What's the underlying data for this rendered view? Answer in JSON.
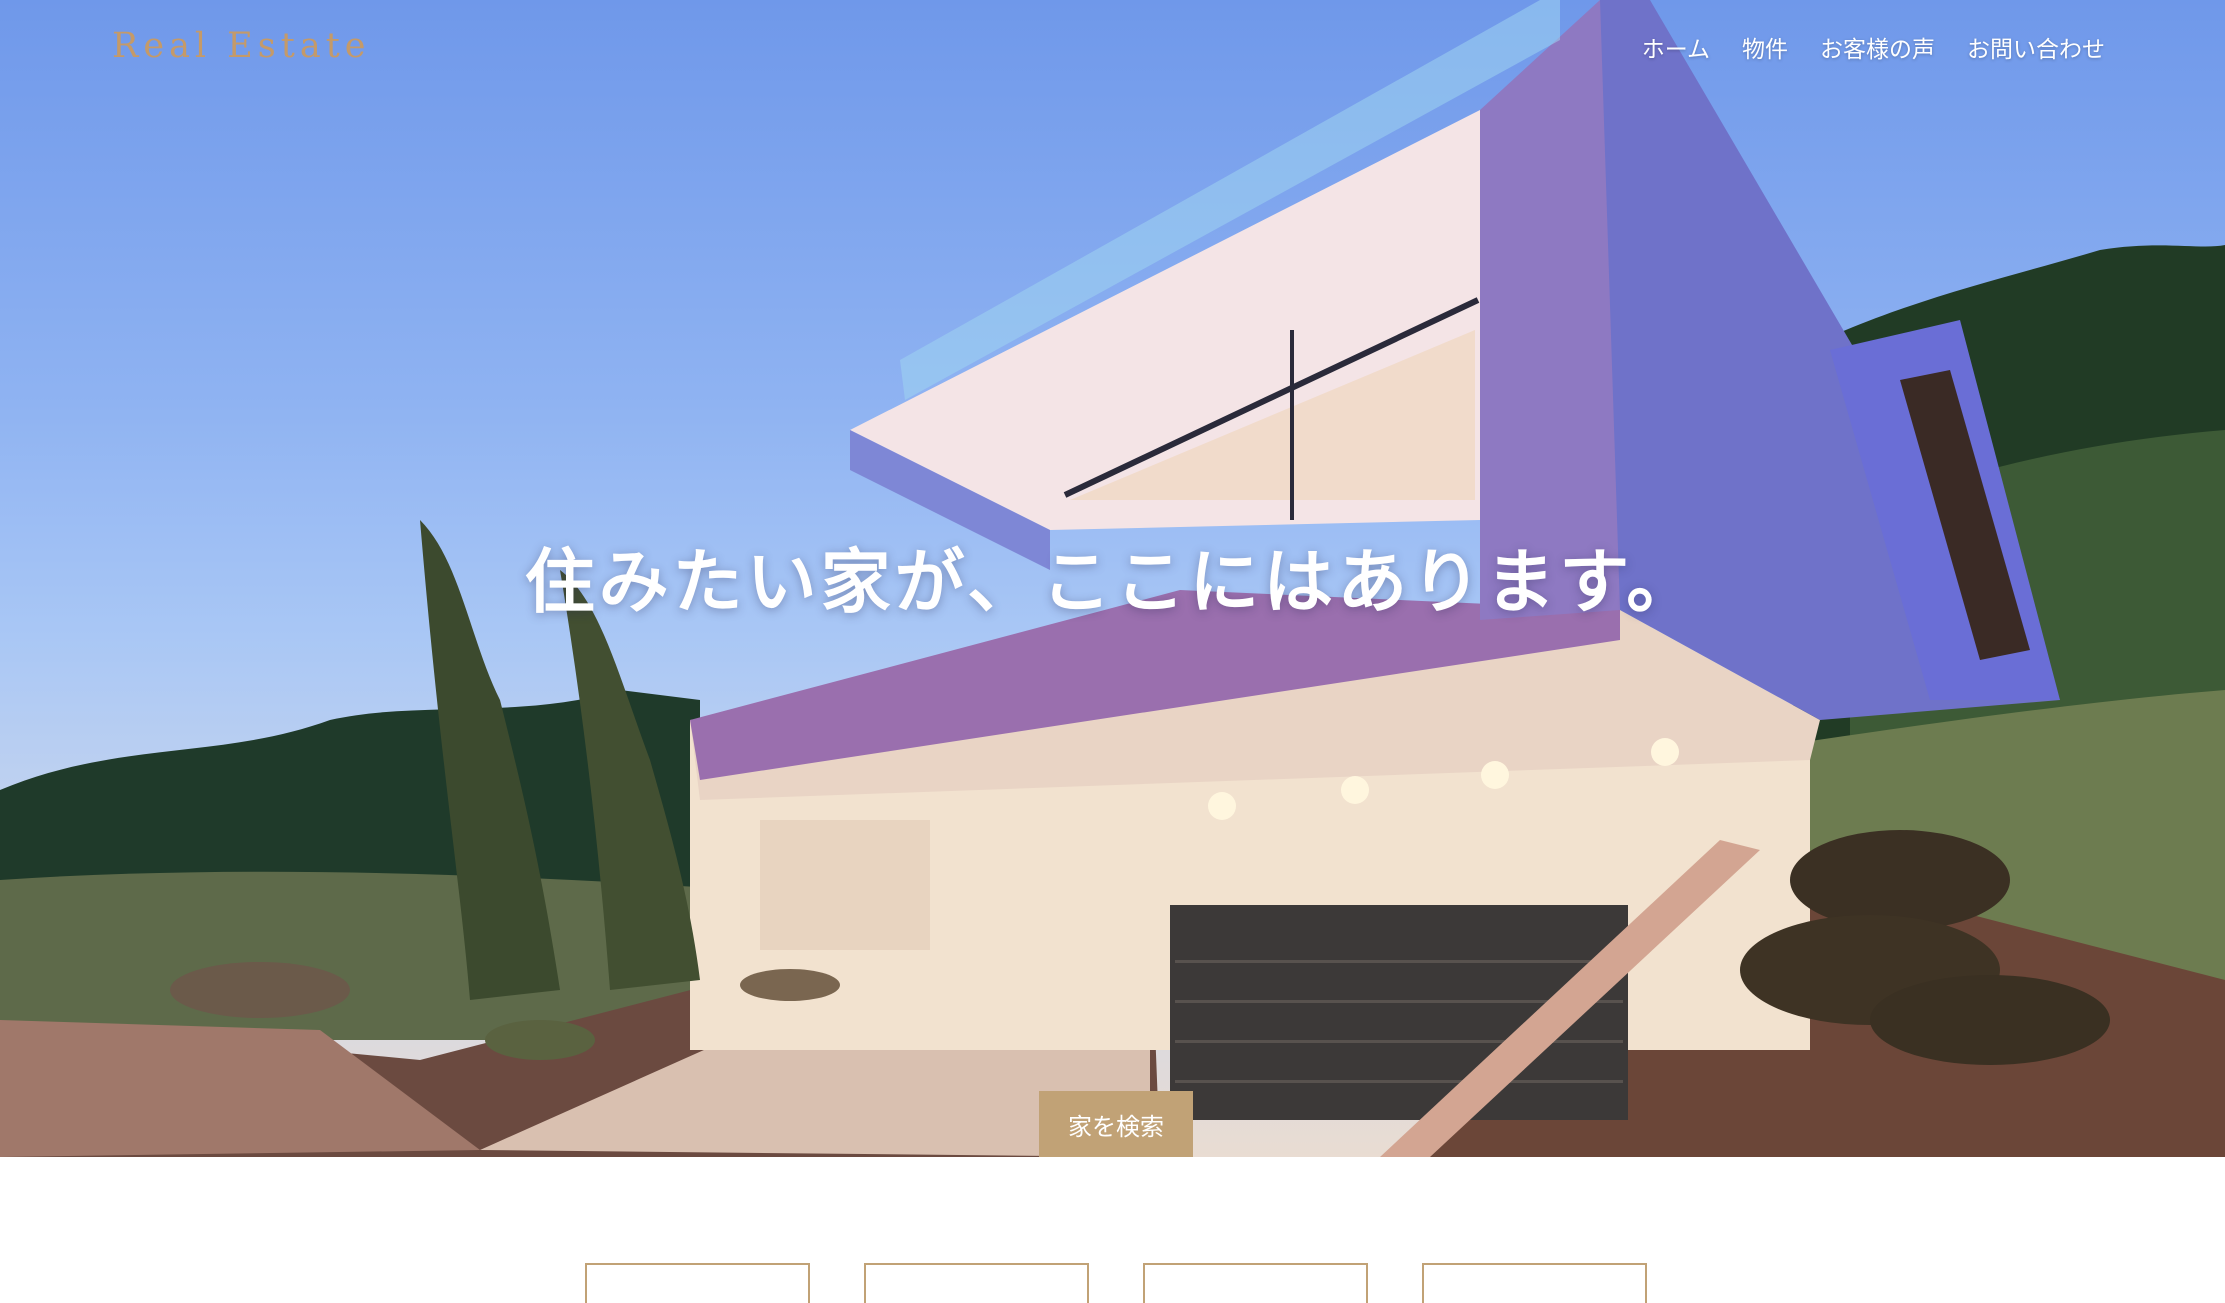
{
  "header": {
    "logo": "Real Estate",
    "nav": [
      "ホーム",
      "物件",
      "お客様の声",
      "お問い合わせ"
    ]
  },
  "hero": {
    "headline": "住みたい家が、ここにはあります。",
    "search_button": "家を検索"
  },
  "colors": {
    "accent": "#c1a276",
    "logo": "#c49a69",
    "sky_top": "#6f98ea"
  },
  "cards_count_visible": 4
}
